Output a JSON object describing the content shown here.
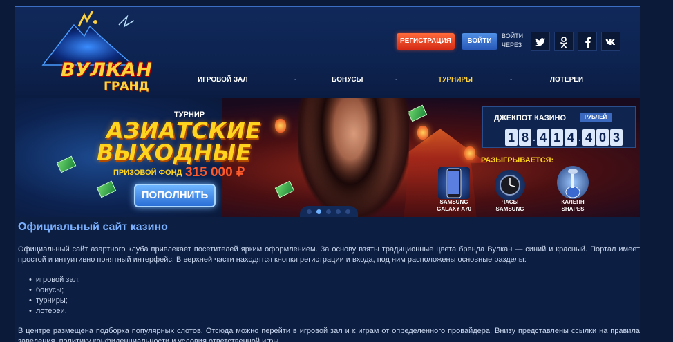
{
  "header": {
    "logo": {
      "word": "ВУЛКАН",
      "sub": "ГРАНД"
    },
    "register_label": "РЕГИСТРАЦИЯ",
    "login_label": "ВОЙТИ",
    "login_via": "ВОЙТИ ЧЕРЕЗ",
    "social": [
      {
        "icon": "twitter-icon",
        "glyph": "t"
      },
      {
        "icon": "odnoklassniki-icon",
        "glyph": "ok"
      },
      {
        "icon": "facebook-icon",
        "glyph": "f"
      },
      {
        "icon": "vk-icon",
        "glyph": "vk"
      }
    ],
    "nav": [
      "ИГРОВОЙ ЗАЛ",
      "БОНУСЫ",
      "ТУРНИРЫ",
      "ЛОТЕРЕИ"
    ],
    "nav_separator": "-",
    "nav_active": "ТУРНИРЫ"
  },
  "banner": {
    "tournament_label": "ТУРНИР",
    "title_line1": "АЗИАТСКИЕ",
    "title_line2": "ВЫХОДНЫЕ",
    "prize_label": "ПРИЗОВОЙ ФОНД",
    "prize_value": "315 000 ₽",
    "topup_label": "ПОПОЛНИТЬ",
    "slides": 5,
    "active_slide": 2
  },
  "jackpot": {
    "label": "ДЖЕКПОТ КАЗИНО",
    "currency": "РУБЛЕЙ",
    "digits": [
      "1",
      "8",
      "4",
      "1",
      "4",
      "4",
      "0",
      "3"
    ]
  },
  "prizes": {
    "label": "РАЗЫГРЫВАЕТСЯ:",
    "items": [
      {
        "line1": "SAMSUNG",
        "line2": "GALAXY A70"
      },
      {
        "line1": "ЧАСЫ",
        "line2": "SAMSUNG"
      },
      {
        "line1": "КАЛЬЯН",
        "line2": "SHAPES"
      }
    ]
  },
  "content": {
    "title": "Официальный сайт казино",
    "paragraph1": "Официальный сайт азартного клуба привлекает посетителей ярким оформлением. За основу взяты традиционные цвета бренда Вулкан — синий и красный. Портал имеет простой и интуитивно понятный интерфейс. В верхней части находятся кнопки регистрации и входа, под ним расположены основные разделы:",
    "list": [
      "игровой зал;",
      "бонусы;",
      "турниры;",
      "лотереи."
    ],
    "paragraph2": "В центре размещена подборка популярных слотов. Отсюда можно перейти в игровой зал и к играм от определенного провайдера. Внизу представлены ссылки на правила заведения, политику конфиденциальности и условия ответственной игры."
  },
  "colors": {
    "accent_red": "#d42a15",
    "accent_blue": "#2858b8",
    "gold": "#ffd23b",
    "title_blue": "#7bb0ff"
  }
}
